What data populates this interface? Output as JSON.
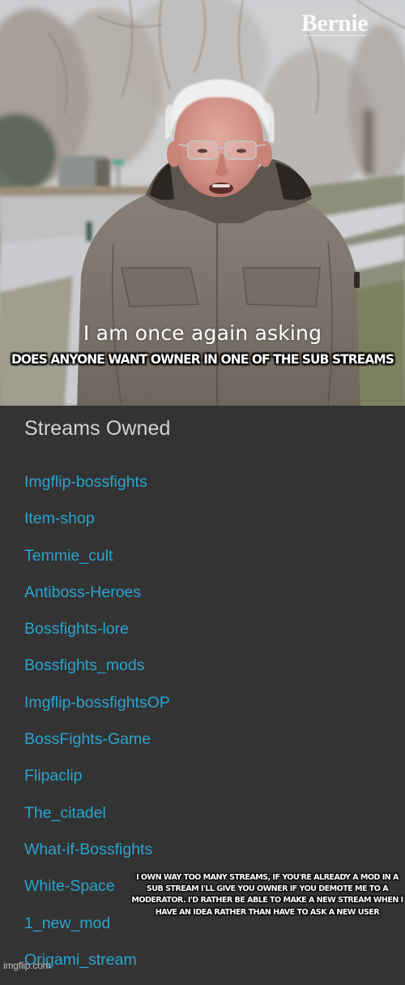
{
  "meme": {
    "photo": {
      "watermark": "Bernie",
      "subtitle": "I am once again asking",
      "top_caption": "DOES ANYONE WANT OWNER IN ONE OF THE SUB STREAMS",
      "colors": {
        "sky": "#d6d8db",
        "coat": "#7f776d",
        "hair": "#eeeeee",
        "skin": "#d59a8f",
        "snow": "#c9cbcf",
        "grass": "#7a7d5c"
      }
    },
    "streams_panel": {
      "title": "Streams Owned",
      "items": [
        "Imgflip-bossfights",
        "Item-shop",
        "Temmie_cult",
        "Antiboss-Heroes",
        "Bossfights-lore",
        "Bossfights_mods",
        "Imgflip-bossfightsOP",
        "BossFights-Game",
        "Flipaclip",
        "The_citadel",
        "What-if-Bossfights",
        "White-Space",
        "1_new_mod",
        "Origami_stream"
      ],
      "colors": {
        "background": "#333333",
        "title": "#d2d2d2",
        "link": "#2aa4cf"
      }
    },
    "bottom_caption": "I OWN WAY TOO MANY STREAMS, IF YOU'RE ALREADY A MOD IN A SUB STREAM I'LL GIVE YOU OWNER IF YOU DEMOTE ME TO A MODERATOR. I'D RATHER BE ABLE TO MAKE A NEW STREAM WHEN I HAVE AN IDEA RATHER THAN HAVE TO ASK A NEW USER",
    "site_watermark": "imgflip.com"
  }
}
